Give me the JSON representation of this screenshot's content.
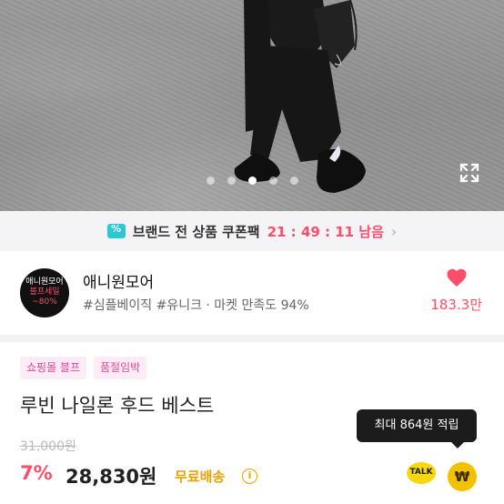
{
  "gallery": {
    "slide_count": 5,
    "active_index": 2,
    "expand_icon": "expand-icon"
  },
  "coupon_bar": {
    "icon": "coupon-icon",
    "text": "브랜드 전 상품 쿠폰팩",
    "timer": "21 : 49 : 11 남음",
    "chevron": "›"
  },
  "shop": {
    "logo_line1": "애니원모어",
    "logo_line2": "블프세일",
    "logo_line3": "~80%",
    "name": "애니원모어",
    "tags": "#심플베이직 #유니크 · 마켓 만족도 94%",
    "like_count": "183.3만"
  },
  "badges": [
    "쇼핑몰 블프",
    "품절임박"
  ],
  "product": {
    "title": "루빈 나일론 후드 베스트",
    "original_price": "31,000원",
    "discount": "7%",
    "sale_price": "28,830원",
    "shipping": "무료배송",
    "info_icon": "i"
  },
  "tooltip": "최대 864원 적립",
  "talk_label": "TALK",
  "won_symbol": "₩",
  "colors": {
    "accent": "#ff4d6a",
    "badge_text": "#e8459b",
    "badge_bg": "#fdebf5",
    "shipping": "#e8a200",
    "coupon_icon": "#2ec7d6",
    "kakao": "#f7d80c"
  }
}
